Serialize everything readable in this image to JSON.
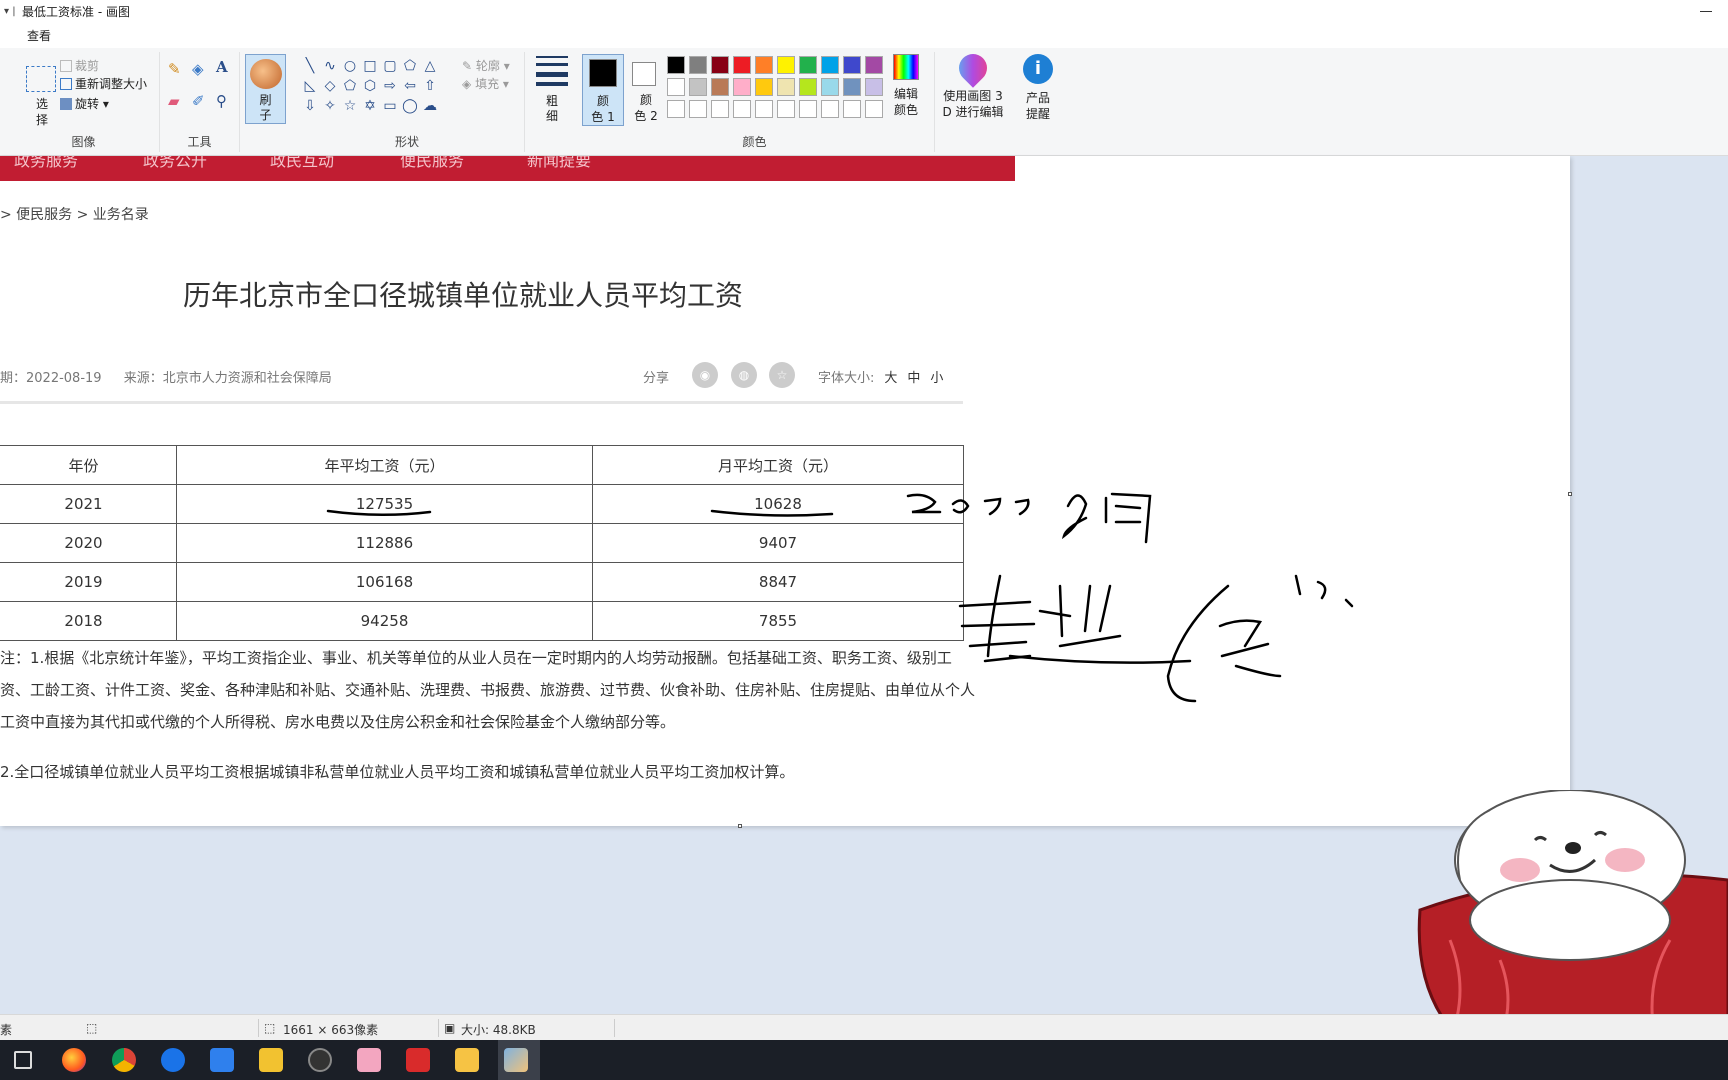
{
  "window": {
    "title": "最低工资标准 - 画图",
    "quick_access": "▾ |"
  },
  "menu": {
    "view_tab": "查看"
  },
  "ribbon": {
    "image": {
      "select": "选\n择",
      "crop": "裁剪",
      "resize": "重新调整大小",
      "rotate": "旋转",
      "label": "图像"
    },
    "tools": {
      "label": "工具"
    },
    "brush": {
      "label": "刷\n子"
    },
    "shapes": {
      "outline": "轮廓",
      "fill": "填充",
      "label": "形状"
    },
    "size": {
      "label": "粗\n细"
    },
    "colors": {
      "color1": "颜\n色 1",
      "color2": "颜\n色 2",
      "edit": "编辑\n颜色",
      "label": "颜色",
      "palette": [
        "#000000",
        "#7f7f7f",
        "#880015",
        "#ed1c24",
        "#ff7f27",
        "#fff200",
        "#22b14c",
        "#00a2e8",
        "#3f48cc",
        "#a349a4",
        "#ffffff",
        "#c3c3c3",
        "#b97a57",
        "#ffaec9",
        "#ffc90e",
        "#efe4b0",
        "#b5e61d",
        "#99d9ea",
        "#7092be",
        "#c8bfe7",
        "#ffffff",
        "#ffffff",
        "#ffffff",
        "#ffffff",
        "#ffffff",
        "#ffffff",
        "#ffffff",
        "#ffffff",
        "#ffffff",
        "#ffffff"
      ]
    },
    "paint3d": "使用画图 3\nD 进行编辑",
    "notice": "产品\n提醒"
  },
  "page": {
    "nav_items": [
      "政务服务",
      "政务公开",
      "政民互动",
      "便民服务",
      "新闻提要"
    ],
    "breadcrumb": "> 便民服务 > 业务名录",
    "title": "历年北京市全口径城镇单位就业人员平均工资",
    "date": "期：2022-08-19",
    "source": "来源：北京市人力资源和社会保障局",
    "share": "分享",
    "font_size_label": "字体大小:",
    "font_sizes": [
      "大",
      "中",
      "小"
    ],
    "table": {
      "headers": [
        "年份",
        "年平均工资（元）",
        "月平均工资（元）"
      ],
      "rows": [
        [
          "2021",
          "127535",
          "10628"
        ],
        [
          "2020",
          "112886",
          "9407"
        ],
        [
          "2019",
          "106168",
          "8847"
        ],
        [
          "2018",
          "94258",
          "7855"
        ]
      ]
    },
    "note1": "注：1.根据《北京统计年鉴》，平均工资指企业、事业、机关等单位的从业人员在一定时期内的人均劳动报酬。包括基础工资、职务工资、级别工资、工龄工资、计件工资、奖金、各种津贴和补贴、交通补贴、洗理费、书报费、旅游费、过节费、伙食补助、住房补贴、住房提贴、由单位从个人工资中直接为其代扣或代缴的个人所得税、房水电费以及住房公积金和社会保险基金个人缴纳部分等。",
    "note2": "2.全口径城镇单位就业人员平均工资根据城镇非私营单位就业人员平均工资和城镇私营单位就业人员平均工资加权计算。"
  },
  "statusbar": {
    "left": "素",
    "dimensions": "1661 × 663像素",
    "size": "大小: 48.8KB"
  }
}
